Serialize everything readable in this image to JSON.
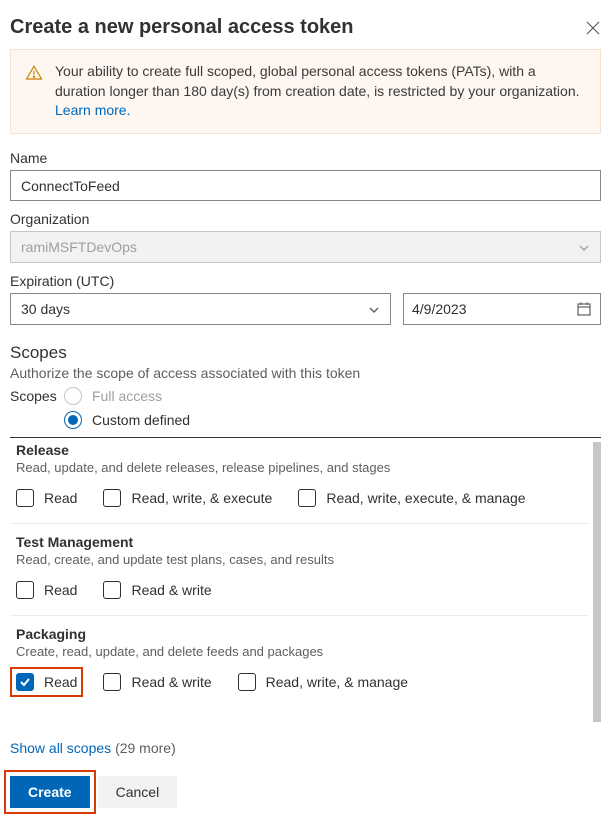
{
  "header": {
    "title": "Create a new personal access token"
  },
  "banner": {
    "text": "Your ability to create full scoped, global personal access tokens (PATs), with a duration longer than 180 day(s) from creation date, is restricted by your organization. ",
    "link": "Learn more."
  },
  "fields": {
    "name_label": "Name",
    "name_value": "ConnectToFeed",
    "org_label": "Organization",
    "org_value": "ramiMSFTDevOps",
    "exp_label": "Expiration (UTC)",
    "exp_duration": "30 days",
    "exp_date": "4/9/2023"
  },
  "scopes": {
    "title": "Scopes",
    "subtitle": "Authorize the scope of access associated with this token",
    "lead_label": "Scopes",
    "full_label": "Full access",
    "custom_label": "Custom defined",
    "groups": [
      {
        "name": "Release",
        "desc": "Read, update, and delete releases, release pipelines, and stages",
        "perms": [
          "Read",
          "Read, write, & execute",
          "Read, write, execute, & manage"
        ],
        "checked": []
      },
      {
        "name": "Test Management",
        "desc": "Read, create, and update test plans, cases, and results",
        "perms": [
          "Read",
          "Read & write"
        ],
        "checked": []
      },
      {
        "name": "Packaging",
        "desc": "Create, read, update, and delete feeds and packages",
        "perms": [
          "Read",
          "Read & write",
          "Read, write, & manage"
        ],
        "checked": [
          0
        ],
        "highlight": 0
      }
    ],
    "show_all_label": "Show all scopes",
    "show_all_count": "(29 more)"
  },
  "footer": {
    "create": "Create",
    "cancel": "Cancel"
  }
}
